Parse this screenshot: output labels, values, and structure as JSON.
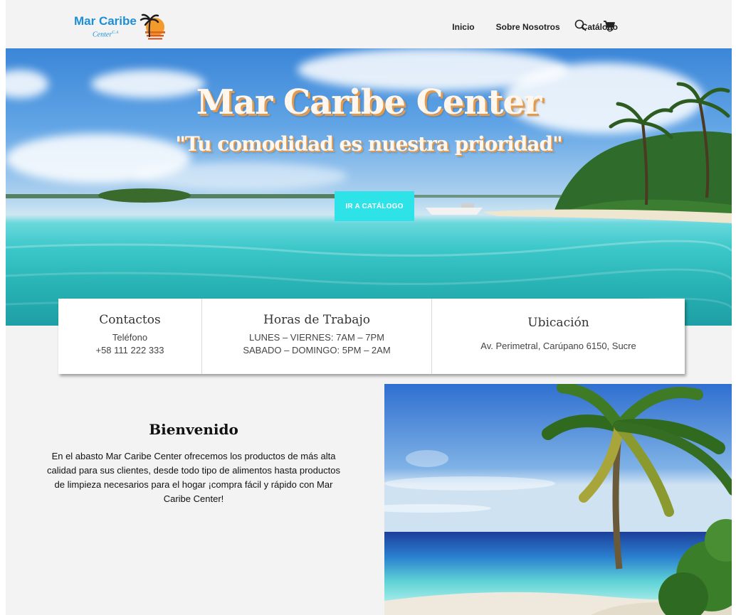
{
  "header": {
    "logo_name": "Mar Caribe",
    "logo_sub": "Center",
    "logo_sup": "C.A",
    "nav": [
      "Inicio",
      "Sobre Nosotros",
      "Catálogo"
    ],
    "icons": [
      "search-icon",
      "cart-icon"
    ]
  },
  "hero": {
    "title": "Mar Caribe Center",
    "subtitle": "\"Tu comodidad es nuestra prioridad\"",
    "button": "IR A CATÁLOGO"
  },
  "info": {
    "contacts": {
      "title": "Contactos",
      "line1": "Teléfono",
      "line2": "+58 111 222 333"
    },
    "hours": {
      "title": "Horas de Trabajo",
      "line1": "LUNES – VIERNES: 7AM – 7PM",
      "line2": "SABADO – DOMINGO: 5PM – 2AM"
    },
    "location": {
      "title": "Ubicación",
      "line1": "Av. Perimetral, Carúpano 6150, Sucre"
    }
  },
  "welcome": {
    "title": "Bienvenido",
    "text": "En el abasto Mar Caribe Center ofrecemos los productos de más alta calidad para sus clientes, desde todo tipo de alimentos hasta productos de limpieza necesarios para el hogar ¡compra fácil y rápido con Mar Caribe Center!"
  },
  "colors": {
    "accent": "#2ee3e8",
    "brand": "#1e8fd6",
    "title_shadow": "#e39a4c"
  }
}
